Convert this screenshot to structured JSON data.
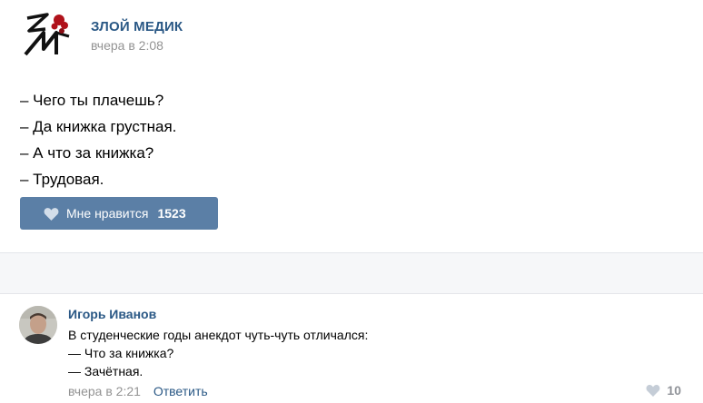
{
  "post": {
    "author": "ЗЛОЙ МЕДИК",
    "time": "вчера в 2:08",
    "lines": [
      "– Чего ты плачешь?",
      "– Да книжка грустная.",
      "– А что за книжка?",
      "– Трудовая."
    ],
    "like_label": "Мне нравится",
    "like_count": "1523"
  },
  "comment": {
    "author": "Игорь Иванов",
    "lines": [
      "В студенческие годы анекдот чуть-чуть отличался:",
      "— Что за книжка?",
      "— Зачётная."
    ],
    "time": "вчера в 2:21",
    "reply_label": "Ответить",
    "like_count": "10"
  },
  "colors": {
    "link": "#2a5885",
    "like_button": "#5b7fa6",
    "muted": "#939393"
  }
}
